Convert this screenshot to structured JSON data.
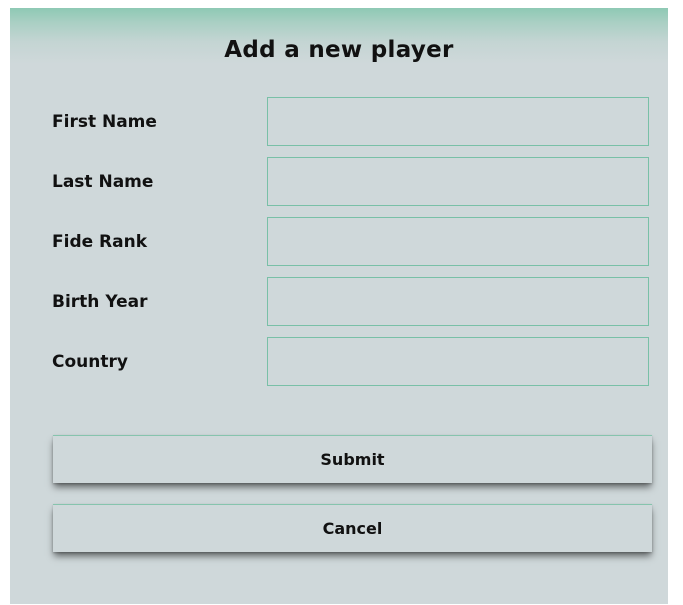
{
  "dialog": {
    "title": "Add a new player",
    "fields": [
      {
        "label": "First Name",
        "value": "",
        "placeholder": ""
      },
      {
        "label": "Last Name",
        "value": "",
        "placeholder": ""
      },
      {
        "label": "Fide Rank",
        "value": "",
        "placeholder": ""
      },
      {
        "label": "Birth Year",
        "value": "",
        "placeholder": ""
      },
      {
        "label": "Country",
        "value": "",
        "placeholder": ""
      }
    ],
    "submit_label": "Submit",
    "cancel_label": "Cancel"
  },
  "colors": {
    "background": "#cfd8da",
    "accent": "#79c0a7",
    "text": "#111111"
  }
}
